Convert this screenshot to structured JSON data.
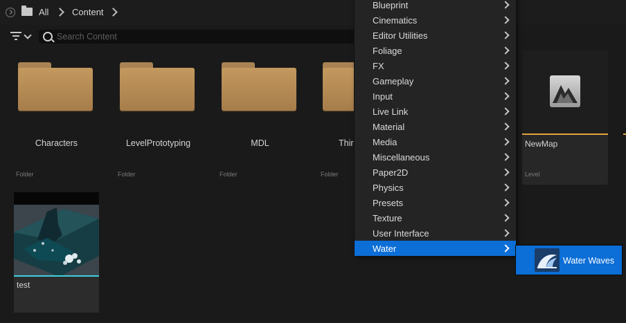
{
  "breadcrumb": {
    "root": "All",
    "current": "Content"
  },
  "search": {
    "placeholder": "Search Content",
    "value": ""
  },
  "folders": [
    {
      "name": "Characters",
      "type": "Folder"
    },
    {
      "name": "LevelPrototyping",
      "type": "Folder"
    },
    {
      "name": "MDL",
      "type": "Folder"
    },
    {
      "name": "Thir",
      "type": "Folder"
    }
  ],
  "map_asset": {
    "name": "NewMap",
    "type": "Level",
    "accent": "#e7a43f"
  },
  "water_asset": {
    "name": "test",
    "accent": "#3fd1e0"
  },
  "context_menu": {
    "items": [
      {
        "label": "Blueprint"
      },
      {
        "label": "Cinematics"
      },
      {
        "label": "Editor Utilities"
      },
      {
        "label": "Foliage"
      },
      {
        "label": "FX"
      },
      {
        "label": "Gameplay"
      },
      {
        "label": "Input"
      },
      {
        "label": "Live Link"
      },
      {
        "label": "Material"
      },
      {
        "label": "Media"
      },
      {
        "label": "Miscellaneous"
      },
      {
        "label": "Paper2D"
      },
      {
        "label": "Physics"
      },
      {
        "label": "Presets"
      },
      {
        "label": "Texture"
      },
      {
        "label": "User Interface"
      },
      {
        "label": "Water",
        "active": true
      }
    ],
    "highlight_color": "#0c6ed7"
  },
  "submenu": {
    "label": "Water Waves",
    "icon": "water-waves-icon"
  }
}
